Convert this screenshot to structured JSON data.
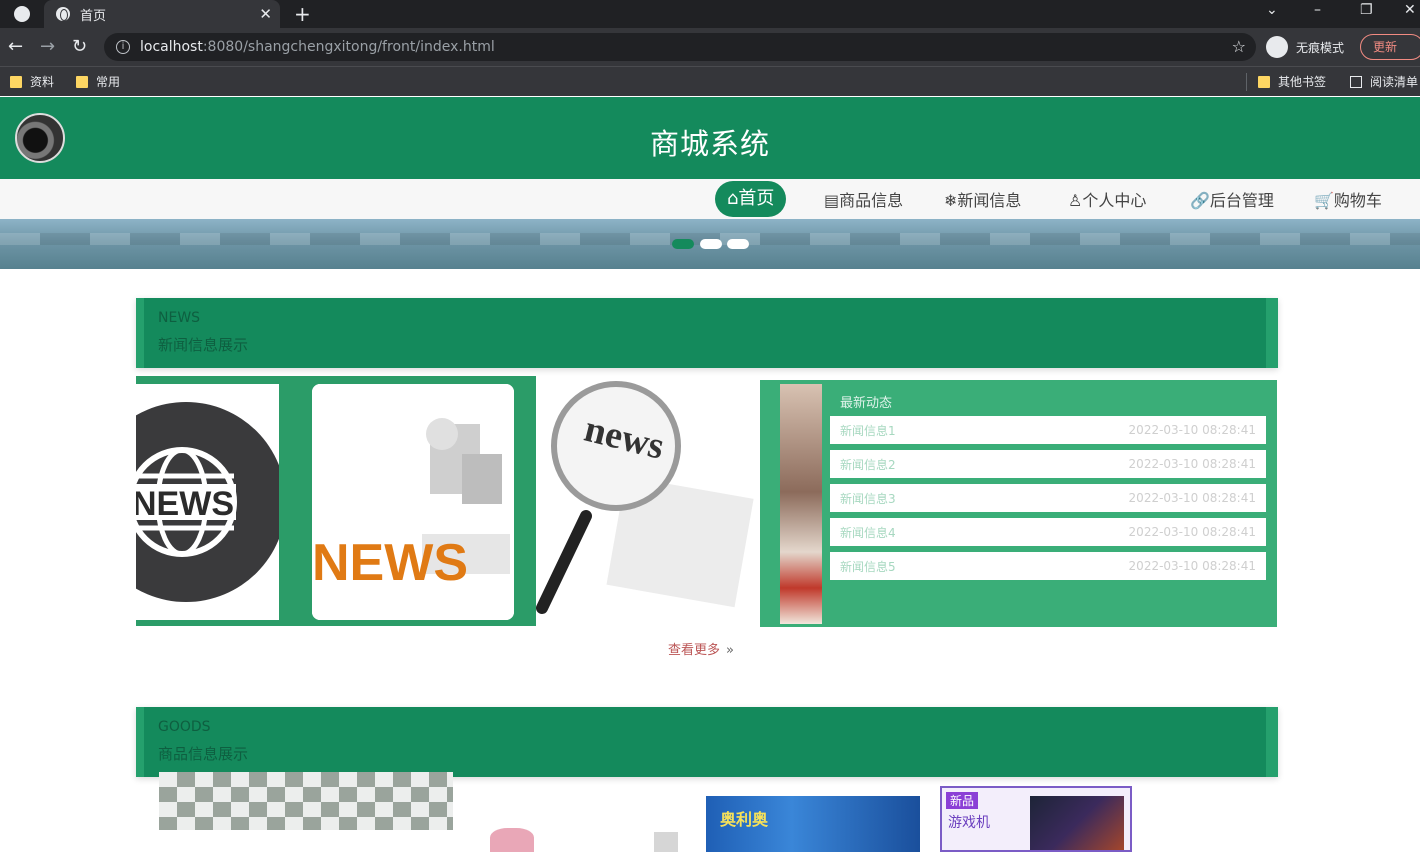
{
  "browser": {
    "tab_title": "首页",
    "url_host": "localhost",
    "url_path": ":8080/shangchengxitong/front/index.html",
    "incognito_label": "无痕模式",
    "update_label": "更新",
    "bookmarks": [
      "资料",
      "常用"
    ],
    "other_bookmarks": "其他书签",
    "reading_list": "阅读清单"
  },
  "site": {
    "title": "商城系统",
    "nav": [
      {
        "icon": "home-icon",
        "label": "⌂首页"
      },
      {
        "icon": "goods-icon",
        "label": "▤商品信息"
      },
      {
        "icon": "news-icon",
        "label": "❄新闻信息"
      },
      {
        "icon": "user-icon",
        "label": "♙个人中心"
      },
      {
        "icon": "link-icon",
        "label": "🔗后台管理"
      },
      {
        "icon": "cart-icon",
        "label": "🛒购物车"
      }
    ]
  },
  "news_section": {
    "en_title": "NEWS",
    "cn_title": "新闻信息展示",
    "panel_title": "最新动态",
    "items": [
      {
        "title": "新闻信息1",
        "date": "2022-03-10 08:28:41"
      },
      {
        "title": "新闻信息2",
        "date": "2022-03-10 08:28:41"
      },
      {
        "title": "新闻信息3",
        "date": "2022-03-10 08:28:41"
      },
      {
        "title": "新闻信息4",
        "date": "2022-03-10 08:28:41"
      },
      {
        "title": "新闻信息5",
        "date": "2022-03-10 08:28:41"
      }
    ],
    "more_label": "查看更多",
    "card_text_1": "NEWS",
    "card_text_2": "NEWS",
    "card_text_3": "news"
  },
  "goods_section": {
    "en_title": "GOODS",
    "cn_title": "商品信息展示",
    "product_text_1": "奥利奥",
    "product_tag_2": "新品",
    "product_text_2": "游戏机"
  },
  "colors": {
    "primary": "#148a5c",
    "primary_light": "#3aae78"
  }
}
